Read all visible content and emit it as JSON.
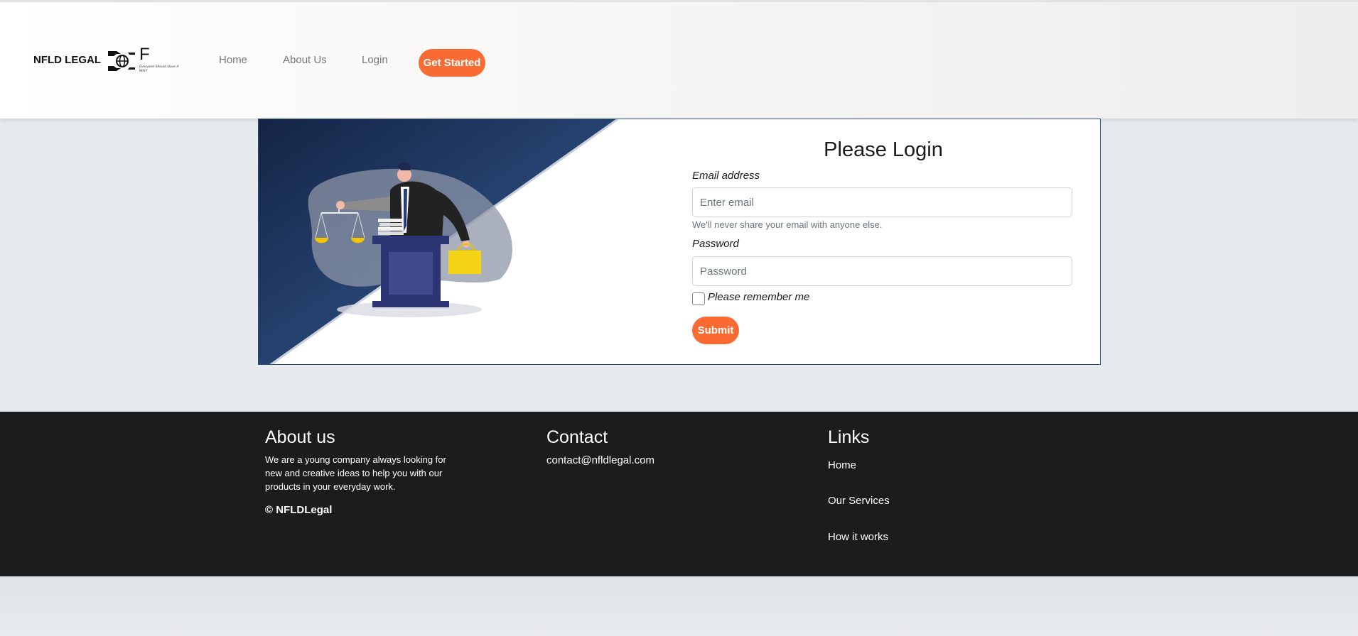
{
  "header": {
    "brand": "NFLD LEGAL",
    "logo_letter": "F",
    "logo_tagline": "Everyone Should Have A Will!!",
    "nav": [
      "Home",
      "About Us",
      "Login"
    ],
    "cta": "Get Started",
    "accent_color": "#fa6b33"
  },
  "login": {
    "title": "Please Login",
    "email_label": "Email address",
    "email_placeholder": "Enter email",
    "email_value": "",
    "email_help": "We'll never share your email with anyone else.",
    "password_label": "Password",
    "password_placeholder": "Password",
    "password_value": "",
    "remember_label": "Please remember me",
    "submit": "Submit"
  },
  "footer": {
    "about_title": "About us",
    "about_text": "We are a young company always looking for new and creative ideas to help you with our products in your everyday work.",
    "copyright": "© NFLDLegal",
    "contact_title": "Contact",
    "contact_email": "contact@nfldlegal.com",
    "links_title": "Links",
    "links": [
      "Home",
      "Our Services",
      "How it works"
    ]
  }
}
